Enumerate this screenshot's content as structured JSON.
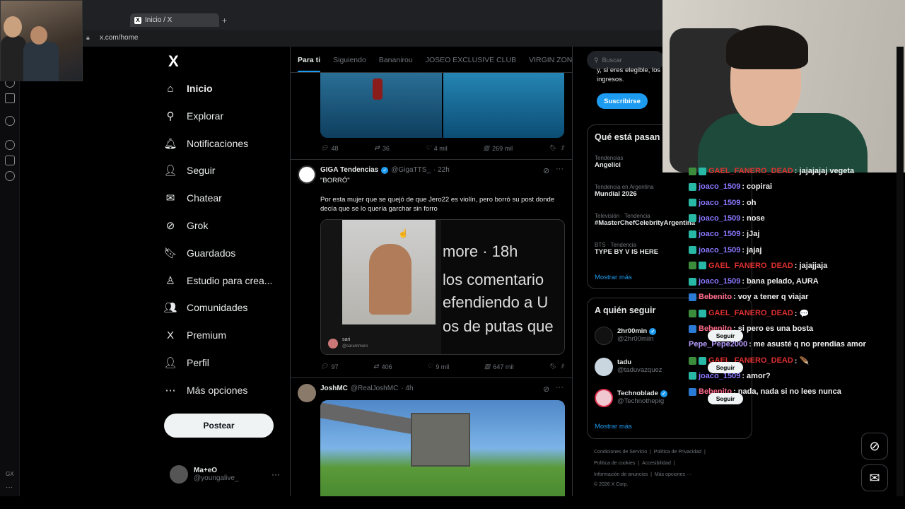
{
  "browser": {
    "tab_title": "Inicio / X",
    "new_tab": "+",
    "url": "x.com/home",
    "gx_label": "GX"
  },
  "sidebar": {
    "logo": "X",
    "items": [
      {
        "label": "Inicio",
        "icon": "home-icon",
        "glyph": "⌂"
      },
      {
        "label": "Explorar",
        "icon": "search-icon",
        "glyph": "⚲"
      },
      {
        "label": "Notificaciones",
        "icon": "bell-icon",
        "glyph": "🔔︎"
      },
      {
        "label": "Seguir",
        "icon": "add-person-icon",
        "glyph": "👤︎"
      },
      {
        "label": "Chatear",
        "icon": "mail-icon",
        "glyph": "✉"
      },
      {
        "label": "Grok",
        "icon": "grok-icon",
        "glyph": "⊘"
      },
      {
        "label": "Guardados",
        "icon": "bookmark-icon",
        "glyph": "🔖︎"
      },
      {
        "label": "Estudio para crea...",
        "icon": "studio-icon",
        "glyph": "♙"
      },
      {
        "label": "Comunidades",
        "icon": "communities-icon",
        "glyph": "👥︎"
      },
      {
        "label": "Premium",
        "icon": "x-premium-icon",
        "glyph": "X"
      },
      {
        "label": "Perfil",
        "icon": "profile-icon",
        "glyph": "👤︎"
      },
      {
        "label": "Más opciones",
        "icon": "more-circle-icon",
        "glyph": "⋯"
      }
    ],
    "post_label": "Postear",
    "profile": {
      "name": "Ma+eO",
      "handle": "@youngalive_",
      "more": "···"
    }
  },
  "timeline": {
    "tabs": [
      "Para ti",
      "Siguiendo",
      "Bananirou",
      "JOSEO EXCLUSIVE CLUB",
      "VIRGIN ZONE"
    ],
    "tweet1_actions": {
      "replies": "48",
      "reposts": "36",
      "likes": "4 mil",
      "views": "269 mil"
    },
    "tweet2": {
      "name": "GIGA Tendencias",
      "handle": "@GigaTTS_",
      "time": "· 22h",
      "quote": "\"BORRÓ\"",
      "text": "Por esta mujer que se quejó de que Jero22 es violín, pero borró su post donde decía que se lo quería garchar sin forro",
      "image_lines": [
        "more · 18h",
        "los comentario",
        "efendiendo a U",
        "os de putas que"
      ],
      "image_user": "sari",
      "image_handle": "@sarammoro",
      "actions": {
        "replies": "97",
        "reposts": "406",
        "likes": "9 mil",
        "views": "647 mil"
      }
    },
    "tweet3": {
      "name": "JoshMC",
      "handle": "@RealJoshMC",
      "time": "· 4h"
    }
  },
  "right": {
    "search_placeholder": "Buscar",
    "subscribe_text": "y, si eres elegible, los ingresos.",
    "subscribe_button": "Suscribirse",
    "trends_title": "Qué está pasan",
    "trends": [
      {
        "category": "Tendencias",
        "name": "Angelici"
      },
      {
        "category": "Tendencia en Argentina",
        "name": "Mundial 2026"
      },
      {
        "category": "Televisión · Tendencia",
        "name": "#MasterChefCelebrityArgentina"
      },
      {
        "category": "BTS · Tendencia",
        "name": "TYPE BY V IS HERE"
      }
    ],
    "show_more": "Mostrar más",
    "who_title": "A quién seguir",
    "who": [
      {
        "name": "2hr00min",
        "handle": "@2hr00miin",
        "verified": true
      },
      {
        "name": "tadu",
        "handle": "@taduvazquez",
        "verified": false
      },
      {
        "name": "Technoblade",
        "handle": "@Technothepig",
        "verified": true
      }
    ],
    "follow_label": "Seguir",
    "who_more": "Mostrar más",
    "footer": [
      [
        "Condiciones de Servicio",
        "|",
        "Política de Privacidad",
        "|"
      ],
      [
        "Política de cookies",
        "|",
        "Accesibilidad",
        "|"
      ],
      [
        "Información de anuncios",
        "|",
        "Más opciones ···"
      ],
      [
        "© 2026 X Corp."
      ]
    ]
  },
  "chat": [
    {
      "user": "GAEL_FANERO_DEAD",
      "msg": ": jajajajaj vegeta",
      "color": "red",
      "badges": [
        "grn",
        "cyan"
      ]
    },
    {
      "user": "joaco_1509",
      "msg": ": copirai",
      "color": "purple",
      "badges": [
        "cyan"
      ]
    },
    {
      "user": "joaco_1509",
      "msg": ": oh",
      "color": "purple",
      "badges": [
        "cyan"
      ]
    },
    {
      "user": "joaco_1509",
      "msg": ": nose",
      "color": "purple",
      "badges": [
        "cyan"
      ]
    },
    {
      "user": "joaco_1509",
      "msg": ": jJaj",
      "color": "purple",
      "badges": [
        "cyan"
      ]
    },
    {
      "user": "joaco_1509",
      "msg": ": jajaj",
      "color": "purple",
      "badges": [
        "cyan"
      ]
    },
    {
      "user": "GAEL_FANERO_DEAD",
      "msg": ": jajajjaja",
      "color": "red",
      "badges": [
        "grn",
        "cyan"
      ]
    },
    {
      "user": "joaco_1509",
      "msg": ": bana pelado, AURA",
      "color": "purple",
      "badges": [
        "cyan"
      ]
    },
    {
      "user": "Bebenito",
      "msg": ": voy a tener q viajar",
      "color": "pink",
      "badges": [
        "blue"
      ]
    },
    {
      "user": "GAEL_FANERO_DEAD",
      "msg": ": 💬",
      "color": "red",
      "badges": [
        "grn",
        "cyan"
      ]
    },
    {
      "user": "Bebenito",
      "msg": ": si pero es una bosta",
      "color": "pink",
      "badges": [
        "blue"
      ]
    },
    {
      "user": "Pepe_Pepe2000",
      "msg": ": me asusté q no prendias amor",
      "color": "lav",
      "badges": []
    },
    {
      "user": "GAEL_FANERO_DEAD",
      "msg": ": 🪶",
      "color": "red",
      "badges": [
        "grn",
        "cyan"
      ]
    },
    {
      "user": "joaco_1509",
      "msg": ": amor?",
      "color": "purple",
      "badges": [
        "cyan"
      ]
    },
    {
      "user": "Bebenito",
      "msg": ": nada, nada si no lees nunca",
      "color": "pink",
      "badges": [
        "blue"
      ]
    }
  ],
  "colors": {
    "accent": "#1d9bf0",
    "background": "#000000",
    "border": "#2f3336"
  }
}
